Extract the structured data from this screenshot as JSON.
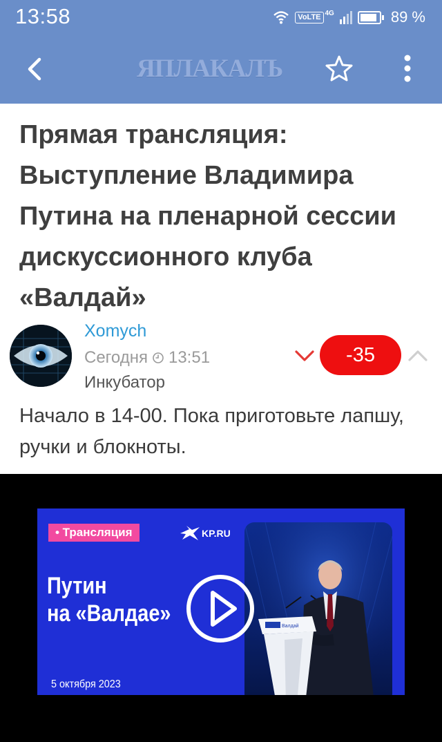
{
  "status": {
    "time": "13:58",
    "volte": "VoLTE",
    "network": "4G",
    "battery": "89 %"
  },
  "appbar": {
    "logo": "ЯПЛАКАЛЪ",
    "back_icon": "chevron-left-icon",
    "favorite_icon": "star-outline-icon",
    "menu_icon": "more-vertical-icon"
  },
  "post": {
    "title": "Прямая трансляция: Выступление Владимира Путина на пленарной сессии дискуссионного клуба «Валдай»",
    "author": "Xomych",
    "date_label": "Сегодня",
    "time": "13:51",
    "category": "Инкубатор",
    "rating": "-35",
    "body": "Начало в 14-00. Пока приготовьте лапшу, ручки и блокноты."
  },
  "video": {
    "tag": "• Трансляция",
    "source": "KP.RU",
    "title_line1": "Путин",
    "title_line2": "на «Валдае»",
    "date": "5 октября 2023",
    "podium_text": "Валдай",
    "play_icon": "play-circle-icon"
  },
  "colors": {
    "appbar": "#6a8ec9",
    "rating_bg": "#ee0f10",
    "author_link": "#2f9ad6",
    "thumbnail_bg": "#1f2fd6",
    "tag_bg": "#f24aa0"
  }
}
